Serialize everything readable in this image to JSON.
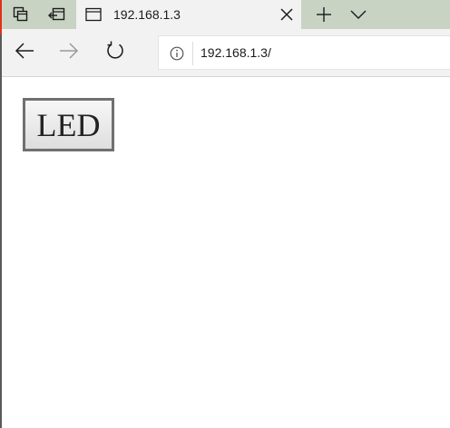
{
  "browser": {
    "tabs": [
      {
        "title": "192.168.1.3",
        "active": true
      }
    ],
    "tab_actions": {
      "tab_preview_icon": "tab-preview-icon",
      "set_aside_icon": "set-aside-tabs-icon",
      "new_tab_icon": "plus-icon",
      "tab_list_icon": "chevron-down-icon"
    },
    "nav": {
      "back_icon": "arrow-left-icon",
      "forward_icon": "arrow-right-icon",
      "refresh_icon": "refresh-icon",
      "forward_enabled": false
    },
    "address": {
      "url": "192.168.1.3/",
      "info_icon": "info-icon"
    }
  },
  "page": {
    "led_button_label": "LED"
  },
  "colors": {
    "tab_strip": "#c9d3c4",
    "toolbar": "#f2f2f2",
    "page_background": "#ffffff",
    "button_border": "#707070"
  }
}
